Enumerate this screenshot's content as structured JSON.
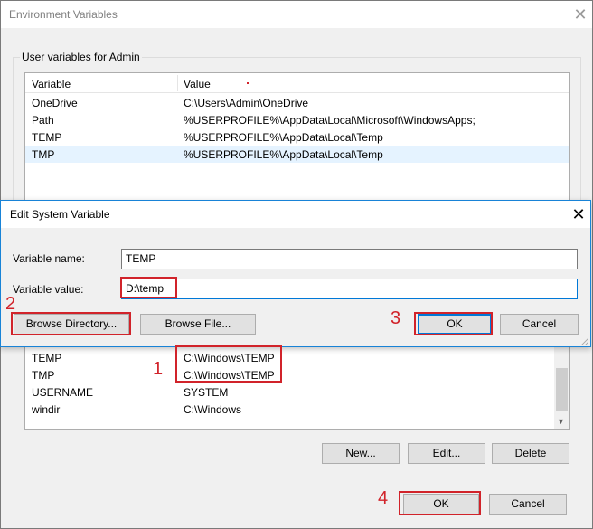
{
  "env_window": {
    "title": "Environment Variables",
    "close_glyph": "✕",
    "user_group_label": "User variables for Admin",
    "user_list": {
      "headers": {
        "variable": "Variable",
        "value": "Value"
      },
      "rows": [
        {
          "variable": "OneDrive",
          "value": "C:\\Users\\Admin\\OneDrive",
          "selected": false
        },
        {
          "variable": "Path",
          "value": "%USERPROFILE%\\AppData\\Local\\Microsoft\\WindowsApps;",
          "selected": false
        },
        {
          "variable": "TEMP",
          "value": "%USERPROFILE%\\AppData\\Local\\Temp",
          "selected": false
        },
        {
          "variable": "TMP",
          "value": "%USERPROFILE%\\AppData\\Local\\Temp",
          "selected": true
        }
      ]
    },
    "system_list": {
      "rows": [
        {
          "variable": "TEMP",
          "value": "C:\\Windows\\TEMP"
        },
        {
          "variable": "TMP",
          "value": "C:\\Windows\\TEMP"
        },
        {
          "variable": "USERNAME",
          "value": "SYSTEM"
        },
        {
          "variable": "windir",
          "value": "C:\\Windows"
        }
      ],
      "scroll_down_glyph": "▼"
    },
    "buttons": {
      "new": "New...",
      "edit": "Edit...",
      "delete": "Delete",
      "ok": "OK",
      "cancel": "Cancel"
    }
  },
  "edit_dialog": {
    "title": "Edit System Variable",
    "close_glyph": "✕",
    "variable_name_label": "Variable name:",
    "variable_name_value": "TEMP",
    "variable_value_label": "Variable value:",
    "variable_value_value": "D:\\temp",
    "buttons": {
      "browse_directory": "Browse Directory...",
      "browse_file": "Browse File...",
      "ok": "OK",
      "cancel": "Cancel"
    }
  },
  "annotations": {
    "step_1": "1",
    "step_2": "2",
    "step_3": "3",
    "step_4": "4",
    "color": "#d1232a"
  }
}
